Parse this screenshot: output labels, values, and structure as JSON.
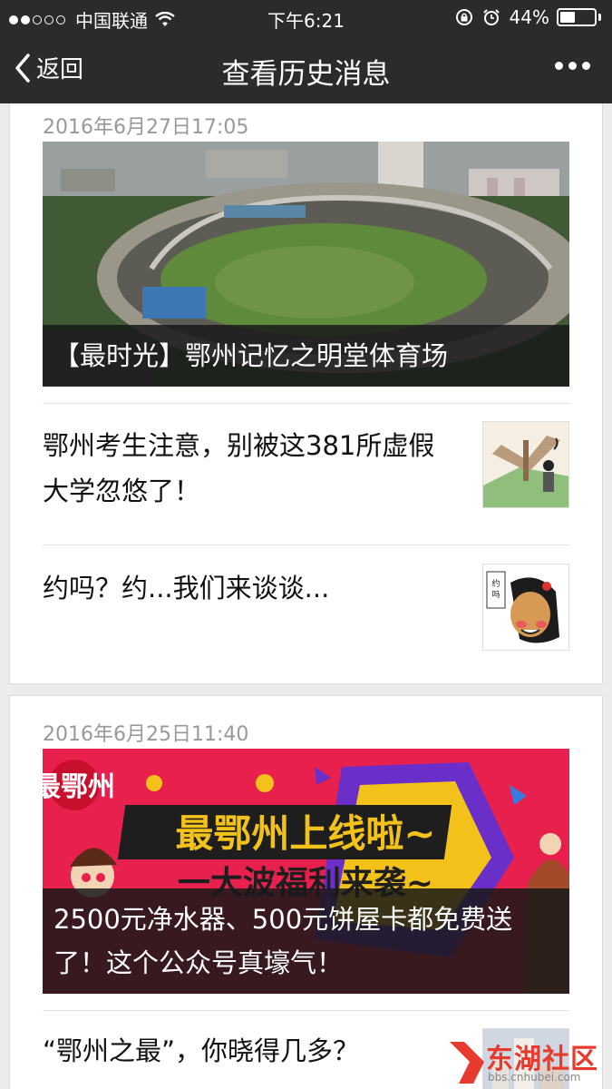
{
  "status_bar": {
    "carrier": "中国联通",
    "time": "下午6:21",
    "battery": "44%",
    "battery_level": 0.44,
    "signal_bars": 2
  },
  "nav": {
    "back_label": "返回",
    "title": "查看历史消息"
  },
  "groups": [
    {
      "date": "2016年6月27日17:05",
      "cover": {
        "title": "【最时光】鄂州记忆之明堂体育场"
      },
      "items": [
        {
          "title": "鄂州考生注意，别被这381所虚假大学忽悠了！"
        },
        {
          "title": "约吗？约...我们来谈谈..."
        }
      ]
    },
    {
      "date": "2016年6月25日11:40",
      "cover": {
        "title": "2500元净水器、500元饼屋卡都免费送了！这个公众号真壕气！",
        "banner_headline": "最鄂州上线啦~",
        "banner_subline": "一大波福利来袭~",
        "logo_text": "最鄂州"
      },
      "items": [
        {
          "title": "“鄂州之最”，你晓得几多？"
        }
      ]
    }
  ],
  "watermark": {
    "text": "东湖社区",
    "url": "bbs.cnhubei.com"
  },
  "colors": {
    "bar": "#2b2b2b",
    "background": "#ececec",
    "date": "#999999",
    "watermark": "#e83a2e"
  },
  "icons": [
    "wifi-icon",
    "lock-rotation-icon",
    "alarm-icon",
    "battery-icon",
    "back-chevron-icon",
    "more-icon"
  ]
}
